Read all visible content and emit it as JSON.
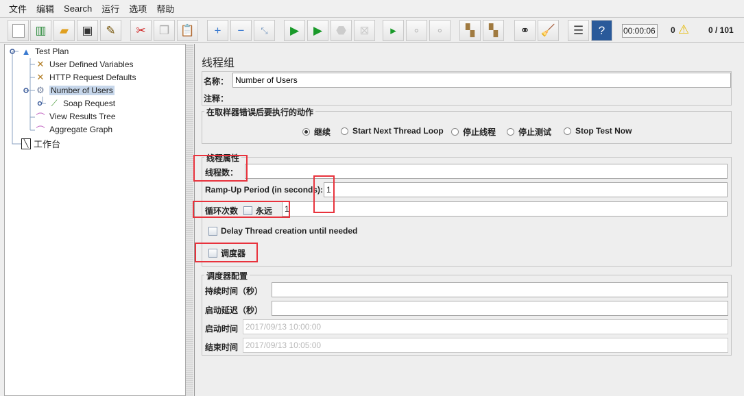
{
  "menu": [
    "文件",
    "编辑",
    "Search",
    "运行",
    "选项",
    "帮助"
  ],
  "toolbar": {
    "icons": [
      "new-icon",
      "templates-icon",
      "open-icon",
      "save-icon",
      "save-as-icon",
      "cut-icon",
      "copy-icon",
      "paste-icon",
      "expand-icon",
      "collapse-icon",
      "toggle-icon",
      "start-icon",
      "start-no-pause-icon",
      "stop-icon",
      "shutdown-icon",
      "remote-start-icon",
      "remote-stop-icon",
      "remote-exit-icon",
      "clear-icon",
      "clear-all-icon",
      "search-icon",
      "reset-search-icon",
      "function-helper-icon",
      "help-icon"
    ],
    "timer": "00:00:06",
    "warnings": "0",
    "threads": "0 / 101"
  },
  "tree": {
    "items": [
      "Test Plan",
      "User Defined Variables",
      "HTTP Request Defaults",
      "Number of Users",
      "Soap Request",
      "View Results Tree",
      "Aggregate Graph",
      "工作台"
    ]
  },
  "panel": {
    "title": "线程组",
    "name_label": "名称：",
    "name_value": "Number of Users",
    "comment_label": "注释：",
    "error_action": {
      "legend": "在取样器错误后要执行的动作",
      "options": [
        "继续",
        "Start Next Thread Loop",
        "停止线程",
        "停止测试",
        "Stop Test Now"
      ],
      "selected": 0
    },
    "thread_props": {
      "legend": "线程属性",
      "threads_label": "线程数：",
      "threads_value": "",
      "rampup_label": "Ramp-Up Period (in seconds):",
      "rampup_value": "1",
      "loop_label": "循环次数",
      "forever_label": "永远",
      "loop_value": "1",
      "delay_label": "Delay Thread creation until needed",
      "scheduler_label": "调度器"
    },
    "scheduler": {
      "legend": "调度器配置",
      "duration_label": "持续时间（秒）",
      "delay_label": "启动延迟（秒）",
      "start_label": "启动时间",
      "start_value": "2017/09/13 10:00:00",
      "end_label": "结束时间",
      "end_value": "2017/09/13 10:05:00"
    }
  }
}
